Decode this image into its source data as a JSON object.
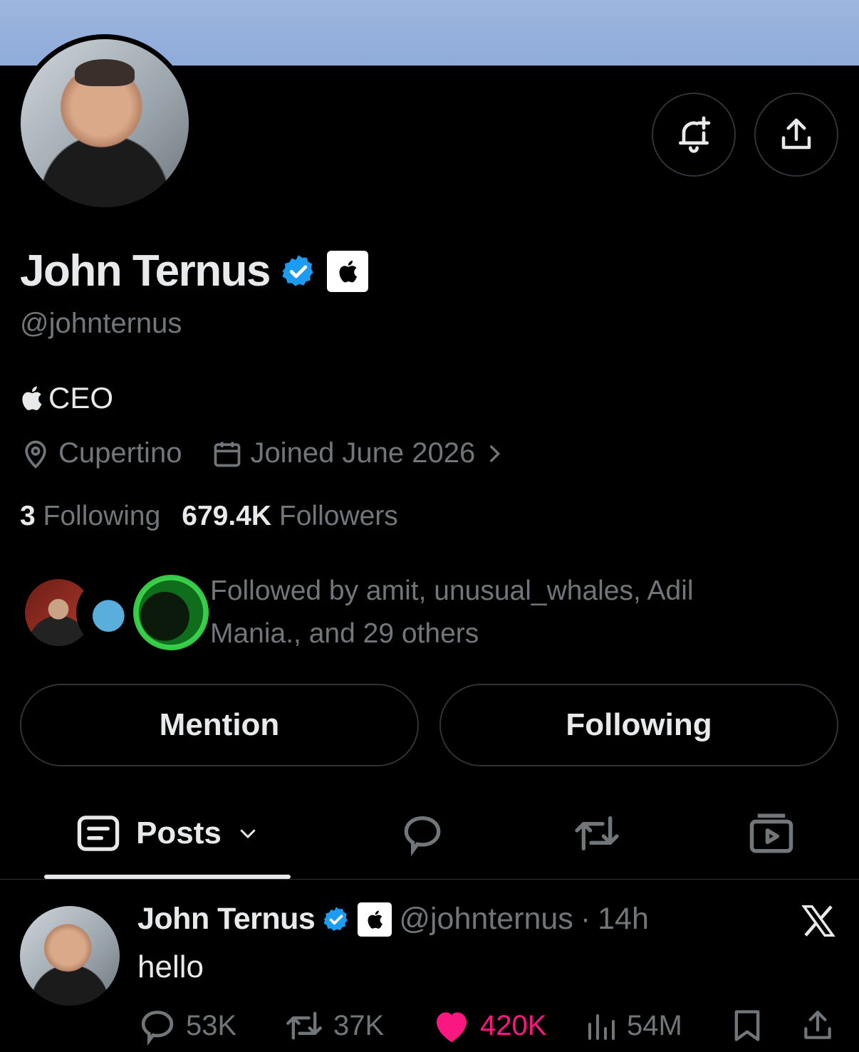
{
  "profile": {
    "name": "John Ternus",
    "handle": "@johnternus",
    "bio": "CEO",
    "location": "Cupertino",
    "joined": "Joined June 2026",
    "following_count": "3",
    "following_label": "Following",
    "followers_count": "679.4K",
    "followers_label": "Followers",
    "followed_by_line1": "Followed by amit, unusual_whales, Adil",
    "followed_by_line2": "Mania., and 29 others"
  },
  "buttons": {
    "mention": "Mention",
    "following": "Following"
  },
  "tabs": {
    "posts": "Posts"
  },
  "post": {
    "name": "John Ternus",
    "handle": "@johnternus",
    "separator": "·",
    "time": "14h",
    "text": "hello",
    "replies": "53K",
    "reposts": "37K",
    "likes": "420K",
    "views": "54M"
  },
  "colors": {
    "background": "#000000",
    "verified_blue": "#1d9bf0",
    "like_pink": "#f91880",
    "muted": "#71767b",
    "banner": "#9db6df"
  },
  "icons": [
    "bell-plus-icon",
    "share-icon",
    "verified-badge-icon",
    "apple-logo-icon",
    "location-icon",
    "calendar-icon",
    "chevron-right-icon",
    "posts-icon",
    "chevron-down-icon",
    "reply-icon",
    "repost-icon",
    "video-icon",
    "x-logo-icon",
    "like-icon",
    "views-icon",
    "bookmark-icon"
  ]
}
